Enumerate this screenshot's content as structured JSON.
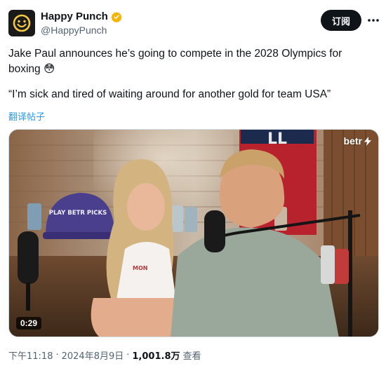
{
  "author": {
    "display_name": "Happy Punch",
    "handle": "@HappyPunch"
  },
  "header": {
    "follow_label": "订阅",
    "more_icon": "more-horizontal-icon",
    "verified_icon": "verified-badge-icon"
  },
  "tweet": {
    "line1": "Jake Paul announces he’s going to compete in the 2028 Olympics for boxing 😳",
    "line2": "“I’m sick and tired of waiting around for another gold for team USA”",
    "translate_label": "翻译帖子"
  },
  "media": {
    "brand": "betr",
    "duration": "0:29",
    "hat_text": "PLAY BETR PICKS",
    "shirt_text": "MON"
  },
  "meta": {
    "time": "下午11:18",
    "separator": "·",
    "date": "2024年8月9日",
    "views_count": "1,001.8万",
    "views_label": "查看"
  },
  "colors": {
    "text": "#0f1419",
    "secondary": "#536471",
    "link": "#1d9bf0",
    "verified": "#f4b400",
    "button_bg": "#0f1419"
  }
}
